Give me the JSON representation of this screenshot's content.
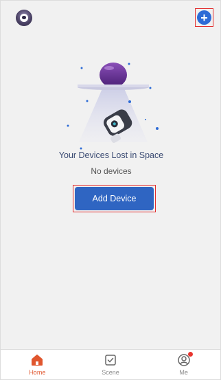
{
  "header": {
    "avatar_icon": "astronaut-avatar-icon",
    "add_icon": "plus-circle-icon",
    "add_symbol": "+"
  },
  "empty_state": {
    "illustration_icon": "lost-in-space-illustration",
    "title": "Your Devices Lost in Space",
    "subtitle": "No devices",
    "button_label": "Add Device"
  },
  "bottom_nav": {
    "items": [
      {
        "label": "Home",
        "icon": "home-icon",
        "active": true
      },
      {
        "label": "Scene",
        "icon": "scene-checkbox-icon",
        "active": false
      },
      {
        "label": "Me",
        "icon": "profile-icon",
        "active": false,
        "badge": true
      }
    ]
  },
  "colors": {
    "accent": "#2f65c2",
    "active_tab": "#e0562e",
    "highlight_box": "#e22d2d",
    "background": "#f1f1f1"
  }
}
